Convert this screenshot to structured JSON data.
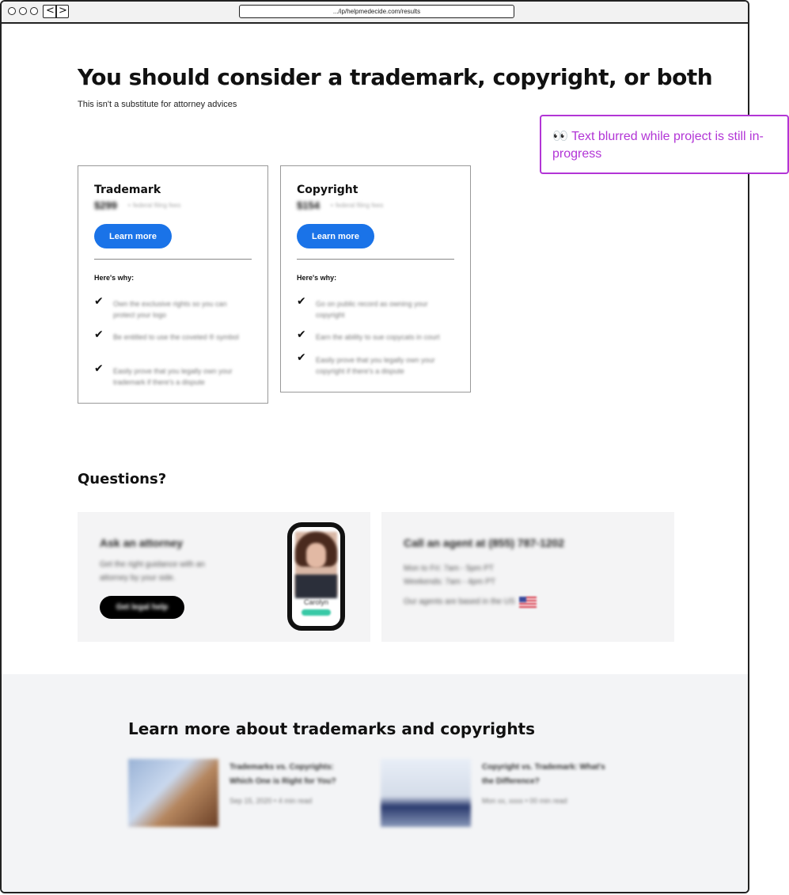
{
  "browser": {
    "url": ".../ip/helpmedecide.com/results",
    "back_glyph": "<",
    "forward_glyph": ">"
  },
  "page": {
    "title": "You should consider a trademark, copyright, or both",
    "subtitle": "This isn't a substitute for attorney advices"
  },
  "note": {
    "emoji": "👀",
    "text": "Text blurred while project is still in-progress",
    "color": "#b235d6"
  },
  "cards": [
    {
      "title": "Trademark",
      "price": "$299",
      "price_note": "+ federal filing fees",
      "button": "Learn more",
      "why_label": "Here's why:",
      "reasons": [
        "Own the exclusive rights so you can protect your logo",
        "Be entitled to use the coveted ® symbol",
        "Easily prove that you legally own your trademark if there's a dispute"
      ]
    },
    {
      "title": "Copyright",
      "price": "$154",
      "price_note": "+ federal filing fees",
      "button": "Learn more",
      "why_label": "Here's why:",
      "reasons": [
        "Go on public record as owning your copyright",
        "Earn the ability to sue copycats in court",
        "Easily prove that you legally own your copyright if there's a dispute"
      ]
    }
  ],
  "questions": {
    "heading": "Questions?",
    "attorney": {
      "title": "Ask an attorney",
      "description": "Get the right guidance with an attorney by your side.",
      "button": "Get legal help",
      "attorney_name": "Carolyn"
    },
    "agent": {
      "title": "Call an agent at (855) 787-1202",
      "hours_weekday": "Mon to Fri: 7am - 5pm PT",
      "hours_weekend": "Weekends: 7am - 4pm PT",
      "based": "Our agents are based in the US"
    }
  },
  "learn_more": {
    "heading": "Learn more about trademarks and copyrights",
    "articles": [
      {
        "title": "Trademarks vs. Copyrights: Which One is Right for You?",
        "meta": "Sep 15, 2020 • 4 min read"
      },
      {
        "title": "Copyright vs. Trademark: What's the Difference?",
        "meta": "Mon xx, xxxx • 00 min read"
      }
    ]
  },
  "colors": {
    "primary_button": "#1a73e8",
    "annotation": "#b235d6",
    "panel_bg": "#f4f4f5"
  }
}
